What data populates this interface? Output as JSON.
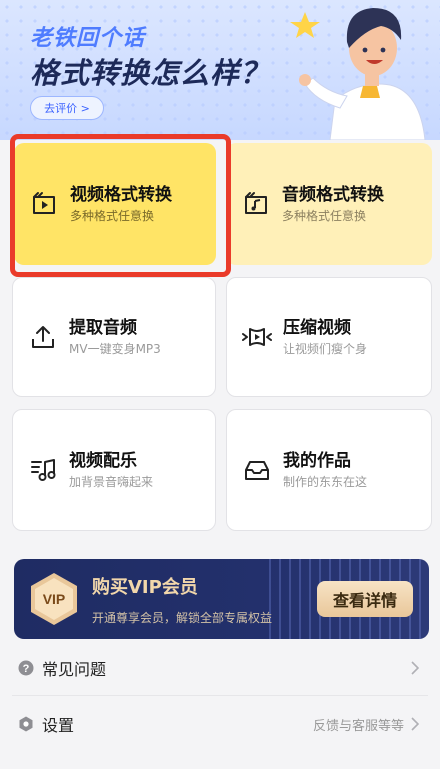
{
  "banner": {
    "line1": "老铁回个话",
    "line2": "格式转换怎么样？",
    "rate_button": "去评价 >"
  },
  "tools": [
    {
      "title": "视频格式转换",
      "subtitle": "多种格式任意换",
      "icon": "video-convert-icon"
    },
    {
      "title": "音频格式转换",
      "subtitle": "多种格式任意换",
      "icon": "audio-convert-icon"
    },
    {
      "title": "提取音频",
      "subtitle": "MV一键变身MP3",
      "icon": "upload-icon"
    },
    {
      "title": "压缩视频",
      "subtitle": "让视频们瘦个身",
      "icon": "compress-video-icon"
    },
    {
      "title": "视频配乐",
      "subtitle": "加背景音嗨起来",
      "icon": "music-note-icon"
    },
    {
      "title": "我的作品",
      "subtitle": "制作的东东在这",
      "icon": "inbox-tray-icon"
    }
  ],
  "vip": {
    "badge": "VIP",
    "title": "购买VIP会员",
    "desc": "开通尊享会员，解锁全部专属权益",
    "button": "查看详情"
  },
  "menu": [
    {
      "label": "常见问题",
      "right": "",
      "icon": "question-icon"
    },
    {
      "label": "设置",
      "right": "反馈与客服等等",
      "icon": "settings-hex-icon"
    }
  ],
  "colors": {
    "highlight": "#ea3b2a",
    "card_primary": "#ffe466",
    "card_secondary": "#fff0b8",
    "vip_bg": "#1f2c63",
    "vip_gold": "#f2d7ab"
  }
}
